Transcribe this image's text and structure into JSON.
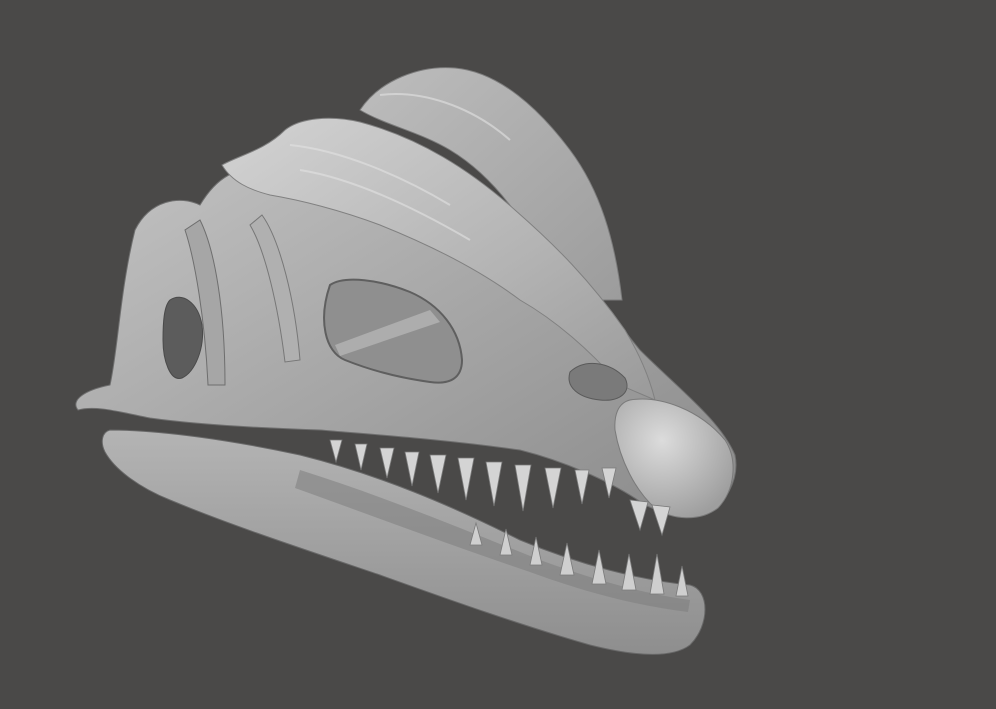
{
  "viewport": {
    "background_color": "#4a4948"
  },
  "model": {
    "subject": "skull-3d-render",
    "base_color": "#a9a9a9",
    "highlight_color": "#d2d2d2",
    "shadow_color": "#7a7a7a",
    "deep_shadow_color": "#5c5c5c",
    "opening_color": "#8f8f8f"
  }
}
